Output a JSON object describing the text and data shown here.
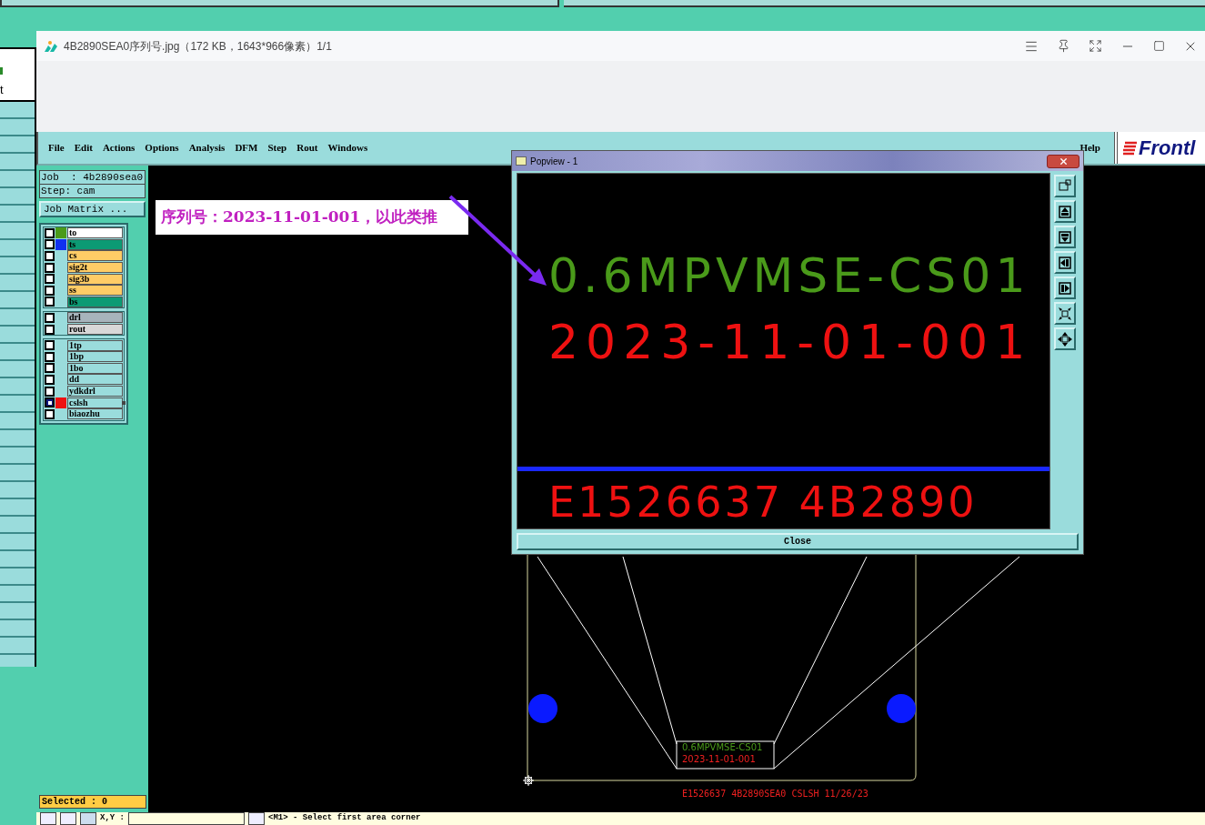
{
  "viewer": {
    "title": "4B2890SEA0序列号.jpg（172 KB，1643*966像素）1/1"
  },
  "background_window": {
    "text": "t"
  },
  "cam": {
    "menu": [
      "File",
      "Edit",
      "Actions",
      "Options",
      "Analysis",
      "DFM",
      "Step",
      "Rout",
      "Windows"
    ],
    "help": "Help",
    "logo": "Frontl",
    "job": "Job  : 4b2890sea0",
    "step": "Step: cam",
    "job_matrix": "Job Matrix ...",
    "layer_groups": [
      [
        {
          "name": "to",
          "kind": "silk",
          "color": "#4a9a1a",
          "selected": false
        },
        {
          "name": "ts",
          "kind": "mask",
          "color": "#1030f0",
          "selected": false
        },
        {
          "name": "cs",
          "kind": "signal",
          "selected": false
        },
        {
          "name": "sig2t",
          "kind": "signal",
          "selected": false
        },
        {
          "name": "sig3b",
          "kind": "signal",
          "selected": false
        },
        {
          "name": "ss",
          "kind": "signal",
          "selected": false
        },
        {
          "name": "bs",
          "kind": "mask",
          "selected": false
        }
      ],
      [
        {
          "name": "drl",
          "kind": "drill",
          "selected": false
        },
        {
          "name": "rout",
          "kind": "rout",
          "selected": false
        }
      ],
      [
        {
          "name": "1tp",
          "kind": "misc",
          "selected": false
        },
        {
          "name": "1bp",
          "kind": "misc",
          "selected": false
        },
        {
          "name": "1bo",
          "kind": "misc",
          "selected": false
        },
        {
          "name": "dd",
          "kind": "misc",
          "selected": false
        },
        {
          "name": "ydkdrl",
          "kind": "misc",
          "selected": false
        },
        {
          "name": "cslsh",
          "kind": "misc",
          "color": "#ee1111",
          "selected": true
        },
        {
          "name": "biaozhu",
          "kind": "misc",
          "selected": false
        }
      ]
    ],
    "selected": "Selected : 0",
    "annotation": "序列号：2023-11-01-001，以此类推",
    "board": {
      "label_1": "0.6MPVMSE-CS01",
      "label_2": "2023-11-01-001",
      "footer": "E1526637 4B2890SEA0 CSLSH 11/26/23"
    },
    "popview": {
      "title": "Popview - 1",
      "line_1": "0.6MPVMSE-CS01",
      "line_2": "2023-11-01-001",
      "line_3": "E1526637 4B2890",
      "close": "Close"
    },
    "status": {
      "coord_label": "X,Y :",
      "prompt": "<M1> - Select first area corner"
    }
  }
}
